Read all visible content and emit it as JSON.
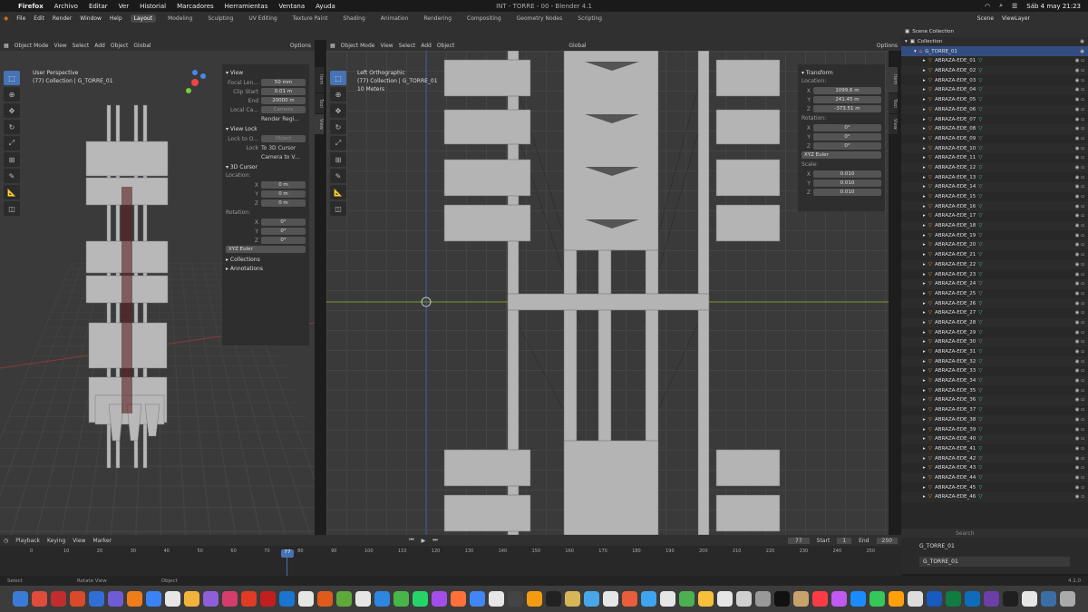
{
  "mac": {
    "apple": "",
    "menus": [
      "Firefox",
      "Archivo",
      "Editar",
      "Ver",
      "Historial",
      "Marcadores",
      "Herramientas",
      "Ventana",
      "Ayuda"
    ],
    "title": "INT - TORRE - 00 - Blender 4.1",
    "clock": "Sáb 4 may 21:23"
  },
  "blender": {
    "menus": [
      "File",
      "Edit",
      "Render",
      "Window",
      "Help"
    ],
    "workspaces": [
      "Layout",
      "Modeling",
      "Sculpting",
      "UV Editing",
      "Texture Paint",
      "Shading",
      "Animation",
      "Rendering",
      "Compositing",
      "Geometry Nodes",
      "Scripting"
    ],
    "active_workspace": "Layout",
    "scene": "Scene",
    "view_layer": "ViewLayer"
  },
  "left_vp": {
    "header": {
      "mode": "Object Mode",
      "menus": [
        "View",
        "Select",
        "Add",
        "Object"
      ],
      "orientation": "Global",
      "options": "Options"
    },
    "info": {
      "line1": "User Perspective",
      "line2": "(77) Collection | G_TORRE_01"
    },
    "npanel": {
      "view_header": "View",
      "focal_label": "Focal Len...",
      "focal": "50 mm",
      "clip_start_label": "Clip Start",
      "clip_start": "0.01 m",
      "end_label": "End",
      "end": "20000 m",
      "local_camera_label": "Local Ca...",
      "local_camera_value": "Camera",
      "render_region": "Render Regi...",
      "view_lock_header": "View Lock",
      "lock_to_label": "Lock to O...",
      "lock_to_value": "Object",
      "lock_label": "Lock",
      "to_3d_cursor": "To 3D Cursor",
      "camera_to_view": "Camera to V...",
      "cursor_header": "3D Cursor",
      "location_label": "Location:",
      "x_label": "X",
      "y_label": "Y",
      "z_label": "Z",
      "cx": "0 m",
      "cy": "0 m",
      "cz": "0 m",
      "rotation_label": "Rotation:",
      "rx": "0°",
      "ry": "0°",
      "rz": "0°",
      "mode": "XYZ Euler",
      "collections": "Collections",
      "annotations": "Annotations"
    },
    "tabs": [
      "Item",
      "Tool",
      "View"
    ]
  },
  "right_vp": {
    "header": {
      "mode": "Object Mode",
      "menus": [
        "View",
        "Select",
        "Add",
        "Object"
      ],
      "orientation": "Global",
      "options": "Options"
    },
    "info": {
      "line1": "Left Orthographic",
      "line2": "(77) Collection | G_TORRE_01",
      "line3": "10 Meters"
    },
    "transform": {
      "header": "Transform",
      "location_label": "Location:",
      "x_label": "X",
      "y_label": "Y",
      "z_label": "Z",
      "lx": "1099.6 m",
      "ly": "241.45 m",
      "lz": "-373.51 m",
      "rotation_label": "Rotation:",
      "rx": "0°",
      "ry": "0°",
      "rz": "0°",
      "mode": "XYZ Euler",
      "scale_label": "Scale:",
      "sx": "0.010",
      "sy": "0.010",
      "sz": "0.010"
    },
    "tabs": [
      "Item",
      "Tool",
      "View"
    ]
  },
  "outliner": {
    "scene_collection": "Scene Collection",
    "collection": "Collection",
    "active": "G_TORRE_01",
    "items": [
      "ABRAZA-EDE_01",
      "ABRAZA-EDE_02",
      "ABRAZA-EDE_03",
      "ABRAZA-EDE_04",
      "ABRAZA-EDE_05",
      "ABRAZA-EDE_06",
      "ABRAZA-EDE_07",
      "ABRAZA-EDE_08",
      "ABRAZA-EDE_09",
      "ABRAZA-EDE_10",
      "ABRAZA-EDE_11",
      "ABRAZA-EDE_12",
      "ABRAZA-EDE_13",
      "ABRAZA-EDE_14",
      "ABRAZA-EDE_15",
      "ABRAZA-EDE_16",
      "ABRAZA-EDE_17",
      "ABRAZA-EDE_18",
      "ABRAZA-EDE_19",
      "ABRAZA-EDE_20",
      "ABRAZA-EDE_21",
      "ABRAZA-EDE_22",
      "ABRAZA-EDE_23",
      "ABRAZA-EDE_24",
      "ABRAZA-EDE_25",
      "ABRAZA-EDE_26",
      "ABRAZA-EDE_27",
      "ABRAZA-EDE_28",
      "ABRAZA-EDE_29",
      "ABRAZA-EDE_30",
      "ABRAZA-EDE_31",
      "ABRAZA-EDE_32",
      "ABRAZA-EDE_33",
      "ABRAZA-EDE_34",
      "ABRAZA-EDE_35",
      "ABRAZA-EDE_36",
      "ABRAZA-EDE_37",
      "ABRAZA-EDE_38",
      "ABRAZA-EDE_39",
      "ABRAZA-EDE_40",
      "ABRAZA-EDE_41",
      "ABRAZA-EDE_42",
      "ABRAZA-EDE_43",
      "ABRAZA-EDE_44",
      "ABRAZA-EDE_45",
      "ABRAZA-EDE_46"
    ],
    "search_placeholder": "Search"
  },
  "properties": {
    "object1": "G_TORRE_01",
    "object2": "G_TORRE_01"
  },
  "timeline": {
    "menus": [
      "Playback",
      "Keying",
      "View",
      "Marker"
    ],
    "current_frame": "77",
    "start_label": "Start",
    "start": "1",
    "end_label": "End",
    "end": "250",
    "ticks": [
      "0",
      "10",
      "20",
      "30",
      "40",
      "50",
      "60",
      "70",
      "80",
      "90",
      "100",
      "110",
      "120",
      "130",
      "140",
      "150",
      "160",
      "170",
      "180",
      "190",
      "200",
      "210",
      "220",
      "230",
      "240",
      "250"
    ]
  },
  "status": {
    "select": "Select",
    "rotate": "Rotate View",
    "object": "Object",
    "version": "4.1.0"
  },
  "dock_colors": [
    "#3a7bd5",
    "#e04b3a",
    "#c12d2d",
    "#d94a2b",
    "#2f6fd6",
    "#6e5bd6",
    "#f07d1a",
    "#3b82f6",
    "#e6e6e6",
    "#f2b33d",
    "#8e5fd6",
    "#d73d6c",
    "#e03b24",
    "#c31e1e",
    "#1c74d1",
    "#e6e6e6",
    "#e05a1b",
    "#5da93a",
    "#e6e6e6",
    "#2e86de",
    "#47b649",
    "#25d366",
    "#a44eea",
    "#ff7139",
    "#4285f4",
    "#e6e6e6",
    "#444444",
    "#f39c12",
    "#222222",
    "#d6b656",
    "#49a6e9",
    "#e6e6e6",
    "#e85d3a",
    "#3ea4f0",
    "#e6e6e6",
    "#4cb050",
    "#f8c03a",
    "#e6e6e6",
    "#d0d0d0",
    "#999999",
    "#111111",
    "#c9a16a",
    "#fc3c44",
    "#bf5af2",
    "#1a8cff",
    "#34c759",
    "#ff9f0a",
    "#dddddd",
    "#185abd",
    "#107c41",
    "#0f6cbd",
    "#6b3ea8",
    "#1f1f1f",
    "#e6e6e6",
    "#3a6ea5",
    "#aaaaaa"
  ]
}
